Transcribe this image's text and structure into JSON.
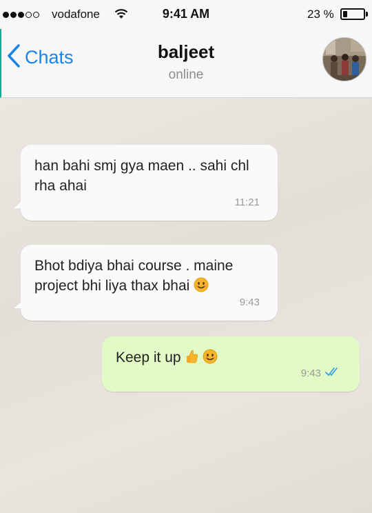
{
  "status_bar": {
    "carrier": "vodafone",
    "time": "9:41 AM",
    "battery_percent_label": "23 %",
    "battery_level": 0.23,
    "signal_bars": 3,
    "signal_max": 5
  },
  "header": {
    "back_label": "Chats",
    "contact_name": "baljeet",
    "contact_status": "online"
  },
  "messages": [
    {
      "direction": "incoming",
      "text": "han bahi smj gya maen .. sahi chl rha ahai",
      "time": "11:21"
    },
    {
      "direction": "incoming",
      "text": "Bhot bdiya bhai course . maine project bhi liya thax bhai",
      "emoji": "smiling-face",
      "time": "9:43"
    },
    {
      "direction": "outgoing",
      "text": "Keep it up",
      "emoji": [
        "thumbs-up",
        "smiling-face"
      ],
      "time": "9:43",
      "receipt": "double-check-read"
    }
  ],
  "colors": {
    "accent_blue": "#1a84e6",
    "outgoing_bubble": "#e2fbc6",
    "incoming_bubble": "#fafafa",
    "read_receipt": "#3aa0e8"
  }
}
